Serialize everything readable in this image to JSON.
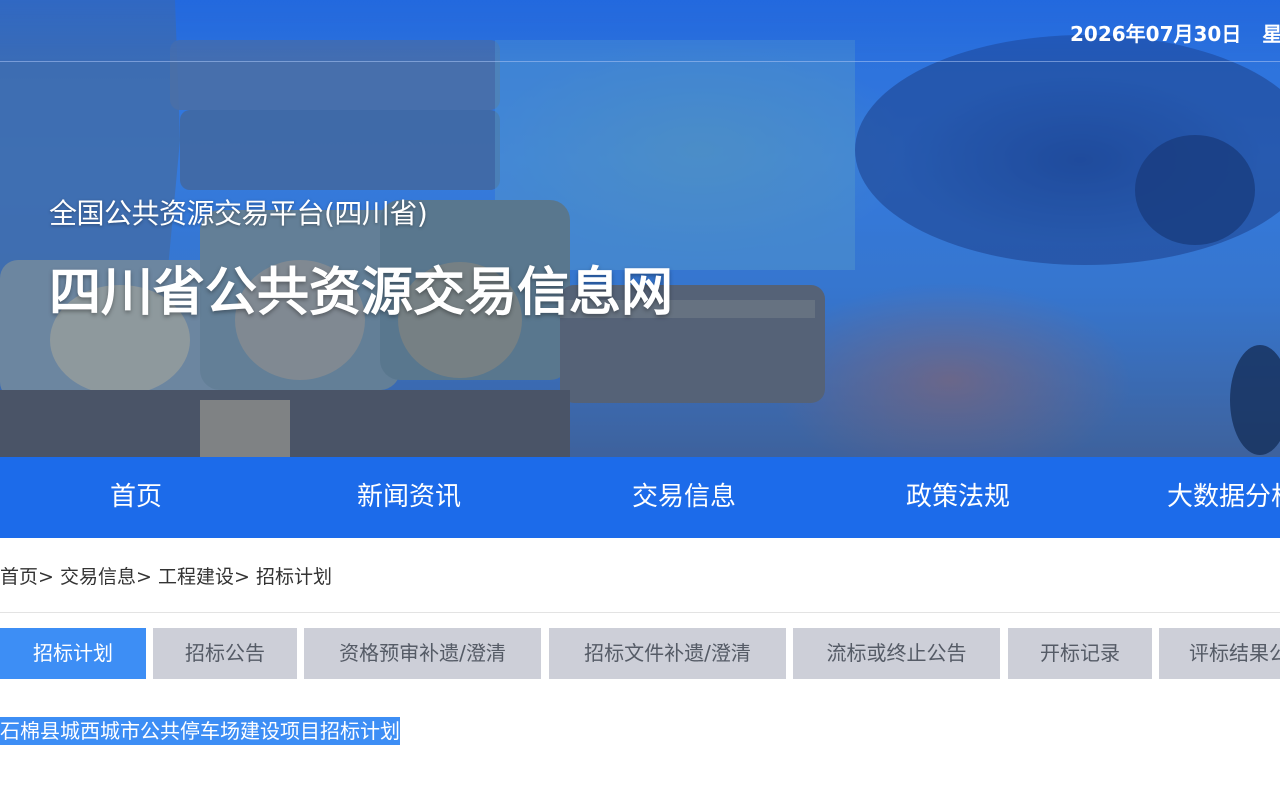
{
  "header": {
    "date": "2026年07月30日",
    "weekday": "星期",
    "platform_subtitle": "全国公共资源交易平台(四川省)",
    "site_title": "四川省公共资源交易信息网"
  },
  "nav": {
    "items": [
      {
        "label": "首页"
      },
      {
        "label": "新闻资讯"
      },
      {
        "label": "交易信息"
      },
      {
        "label": "政策法规"
      },
      {
        "label": "大数据分析"
      }
    ]
  },
  "breadcrumb": {
    "items": [
      {
        "label": "首页"
      },
      {
        "label": "交易信息"
      },
      {
        "label": "工程建设"
      },
      {
        "label": "招标计划"
      }
    ],
    "separator": ">"
  },
  "tabs": [
    {
      "label": "招标计划",
      "active": true
    },
    {
      "label": "招标公告"
    },
    {
      "label": "资格预审补遗/澄清"
    },
    {
      "label": "招标文件补遗/澄清"
    },
    {
      "label": "流标或终止公告"
    },
    {
      "label": "开标记录"
    },
    {
      "label": "评标结果公示"
    }
  ],
  "results": [
    {
      "title": "石棉县城西城市公共停车场建设项目招标计划",
      "selected": true
    }
  ],
  "colors": {
    "nav_bg": "#1c6bea",
    "tab_active_bg": "#3d8ef5",
    "tab_bg": "#cdcfd8",
    "selection_bg": "#3d8ef5"
  }
}
